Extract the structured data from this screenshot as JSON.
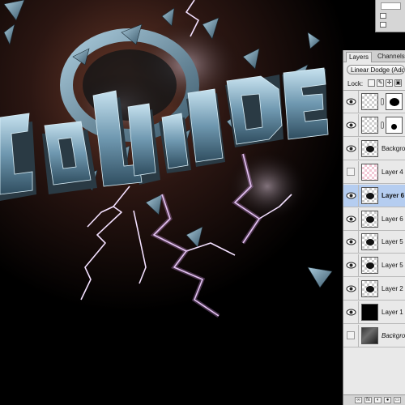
{
  "artwork": {
    "title_text": "COLLIDE",
    "description": "3D metallic text with shattered shards and lightning"
  },
  "layers_panel": {
    "tabs": [
      "Layers",
      "Channels"
    ],
    "active_tab": "Layers",
    "blend_mode": "Linear Dodge (Add)",
    "lock_label": "Lock:",
    "layers": [
      {
        "name": "",
        "visible": true,
        "thumb": "checker",
        "mask": "mask1",
        "selected": false
      },
      {
        "name": "",
        "visible": true,
        "thumb": "checker",
        "mask": "mask2",
        "selected": false
      },
      {
        "name": "Backgro",
        "visible": true,
        "thumb": "checker",
        "mask": "",
        "selected": false
      },
      {
        "name": "Layer 4",
        "visible": false,
        "thumb": "pinkcheck",
        "mask": "",
        "selected": false
      },
      {
        "name": "Layer 6",
        "visible": true,
        "thumb": "checker",
        "mask": "",
        "selected": true
      },
      {
        "name": "Layer 6",
        "visible": true,
        "thumb": "checker",
        "mask": "",
        "selected": false
      },
      {
        "name": "Layer 5 c",
        "visible": true,
        "thumb": "checker",
        "mask": "",
        "selected": false
      },
      {
        "name": "Layer 5",
        "visible": true,
        "thumb": "checker",
        "mask": "",
        "selected": false
      },
      {
        "name": "Layer 2",
        "visible": true,
        "thumb": "checker",
        "mask": "",
        "selected": false
      },
      {
        "name": "Layer 1",
        "visible": true,
        "thumb": "black",
        "mask": "",
        "selected": false
      },
      {
        "name": "Backgrov",
        "visible": false,
        "thumb": "photo",
        "mask": "",
        "selected": false,
        "italic": true
      }
    ]
  },
  "colors": {
    "panel_bg": "#e9e9e9",
    "selected_row": "#b5cdf0",
    "lightning": "#f0d8ff",
    "metal": "#8fb4c8"
  }
}
